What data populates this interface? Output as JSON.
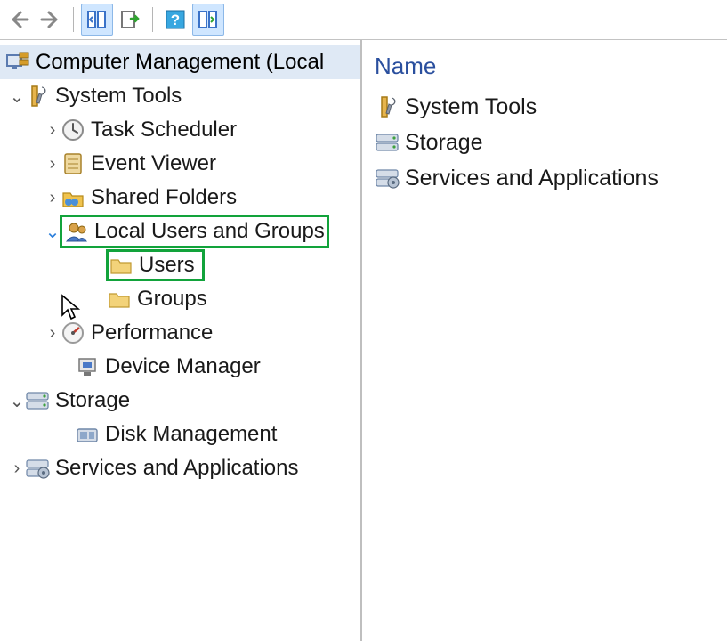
{
  "toolbar": {
    "back": "Back",
    "forward": "Forward",
    "show_hide": "Show/Hide Console Tree",
    "export": "Export List",
    "help": "Help",
    "action": "Show/Hide Action Pane"
  },
  "tree": {
    "root": "Computer Management (Local",
    "system_tools": "System Tools",
    "task_scheduler": "Task Scheduler",
    "event_viewer": "Event Viewer",
    "shared_folders": "Shared Folders",
    "local_users_groups": "Local Users and Groups",
    "users": "Users",
    "groups": "Groups",
    "performance": "Performance",
    "device_manager": "Device Manager",
    "storage": "Storage",
    "disk_management": "Disk Management",
    "services_apps": "Services and Applications"
  },
  "detail": {
    "header": "Name",
    "rows": {
      "system_tools": "System Tools",
      "storage": "Storage",
      "services_apps": "Services and Applications"
    }
  }
}
